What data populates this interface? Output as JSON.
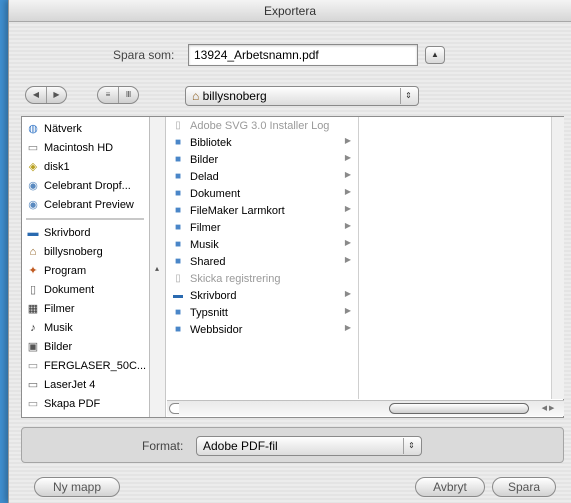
{
  "window": {
    "title": "Exportera"
  },
  "save": {
    "label": "Spara som:",
    "filename": "13924_Arbetsnamn.pdf",
    "toggle_icon": "chevron-up-icon"
  },
  "toolbar": {
    "back_icon": "back-arrow-icon",
    "forward_icon": "forward-arrow-icon",
    "list_view_icon": "list-view-icon",
    "column_view_icon": "column-view-icon",
    "location": "billysnoberg",
    "location_icon": "home-icon"
  },
  "sidebar": {
    "devices": [
      {
        "label": "Nätverk",
        "icon": "network-globe-icon"
      },
      {
        "label": "Macintosh HD",
        "icon": "hard-drive-icon"
      },
      {
        "label": "disk1",
        "icon": "disk-image-icon"
      },
      {
        "label": "Celebrant Dropf...",
        "icon": "network-volume-icon"
      },
      {
        "label": "Celebrant Preview",
        "icon": "network-volume-icon"
      }
    ],
    "places": [
      {
        "label": "Skrivbord",
        "icon": "desktop-icon"
      },
      {
        "label": "billysnoberg",
        "icon": "home-icon"
      },
      {
        "label": "Program",
        "icon": "applications-icon"
      },
      {
        "label": "Dokument",
        "icon": "documents-icon"
      },
      {
        "label": "Filmer",
        "icon": "movies-icon"
      },
      {
        "label": "Musik",
        "icon": "music-icon"
      },
      {
        "label": "Bilder",
        "icon": "pictures-icon"
      },
      {
        "label": "FERGLASER_50C...",
        "icon": "printer-icon"
      },
      {
        "label": "LaserJet 4",
        "icon": "printer-icon"
      },
      {
        "label": "Skapa PDF",
        "icon": "printer-icon"
      }
    ]
  },
  "column1": [
    {
      "label": "Adobe SVG 3.0 Installer Log",
      "dim": true,
      "folder": false
    },
    {
      "label": "Bibliotek",
      "dim": false,
      "folder": true
    },
    {
      "label": "Bilder",
      "dim": false,
      "folder": true
    },
    {
      "label": "Delad",
      "dim": false,
      "folder": true
    },
    {
      "label": "Dokument",
      "dim": false,
      "folder": true
    },
    {
      "label": "FileMaker Larmkort",
      "dim": false,
      "folder": true
    },
    {
      "label": "Filmer",
      "dim": false,
      "folder": true
    },
    {
      "label": "Musik",
      "dim": false,
      "folder": true
    },
    {
      "label": "Shared",
      "dim": false,
      "folder": true
    },
    {
      "label": "Skicka registrering",
      "dim": true,
      "folder": false
    },
    {
      "label": "Skrivbord",
      "dim": false,
      "folder": true
    },
    {
      "label": "Typsnitt",
      "dim": false,
      "folder": true
    },
    {
      "label": "Webbsidor",
      "dim": false,
      "folder": true
    }
  ],
  "format": {
    "label": "Format:",
    "value": "Adobe PDF-fil"
  },
  "buttons": {
    "new_folder": "Ny mapp",
    "cancel": "Avbryt",
    "save": "Spara"
  },
  "colors": {
    "desktop": "#3f8fd0",
    "folder": "#6aa6e0"
  }
}
